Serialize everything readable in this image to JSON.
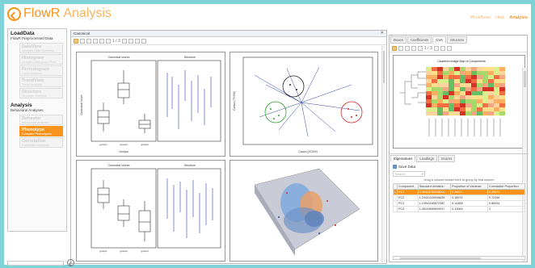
{
  "app": {
    "title_part1": "FlowR",
    "title_part2": "Analysis"
  },
  "topnav": [
    "Workflows",
    "Help",
    "Analysis"
  ],
  "left": {
    "section1_title": "LoadData",
    "section1_sub": "FlowR Preprocessed Data",
    "items_top": [
      {
        "name": "DataView",
        "sub": "Analysis Data Overview"
      },
      {
        "name": "Histogram",
        "sub": "Analysis Histogram Plots"
      },
      {
        "name": "Periodogram",
        "sub": "Cycle Analysis"
      },
      {
        "name": "TrendView",
        "sub": "Trend Analysis"
      },
      {
        "name": "Structure",
        "sub": "Structure Analysis"
      }
    ],
    "section2_title": "Analysis",
    "section2_sub": "Behavioral Analyses",
    "items_bottom": [
      {
        "name": "Behavior",
        "sub": "Behavioral Analysis"
      },
      {
        "name": "Phenotype",
        "sub": "Compare Phenotypes"
      },
      {
        "name": "Correlation",
        "sub": "Correlation Analysis"
      }
    ]
  },
  "center": {
    "title": "Canonical",
    "page": "1 / 3",
    "plot1": {
      "title1": "Canonical scores",
      "title2": "Structure",
      "xlabel": "Groups",
      "ylabel": "Canonical score",
      "categories": [
        "group1",
        "group2",
        "group3"
      ]
    },
    "plot3": {
      "title1": "Canonical scores",
      "title2": "Structure",
      "categories": [
        "group1",
        "group2",
        "group3"
      ]
    },
    "plot2": {
      "xlabel": "Canon (20.5%)",
      "ylabel": "Canon (79.5%)"
    }
  },
  "right": {
    "tabs": [
      "Boxes",
      "Coefficients",
      "CVA",
      "Structure"
    ],
    "page": "1 / 3",
    "heatmap_title": "Clustered Image Map of Components",
    "lower_tabs": [
      "Eigenvalues",
      "Loadings",
      "Scores"
    ],
    "save_label": "Save Data",
    "search_placeholder": "Search",
    "group_hint": "Drag a column header here to group by that column",
    "table": {
      "headers": [
        "Component",
        "Standard deviation",
        "Proportion of Variance",
        "Cumulative Proportion"
      ],
      "rows": [
        [
          "PC1",
          "2.46413700006000",
          "0.46671",
          "0.46671"
        ],
        [
          "PC2",
          "1.29431335998839",
          "0.18576",
          "0.72446"
        ],
        [
          "PC3",
          "1.10941165572382",
          "0.14488",
          "0.86934"
        ],
        [
          "PC4",
          "1.05109655909917",
          "0.13066",
          "1"
        ]
      ]
    }
  },
  "colors": {
    "accent": "#f7941d",
    "background": "#7fd3d8",
    "ellipse_green": "#2ca02c",
    "ellipse_red": "#d62728",
    "ellipse_blue": "#1f4fa0"
  }
}
